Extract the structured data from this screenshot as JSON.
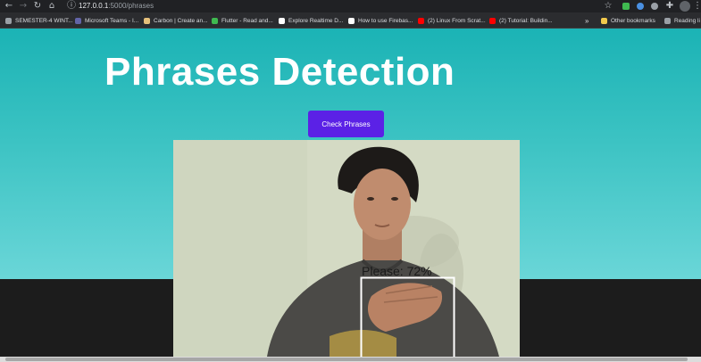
{
  "browser": {
    "url_host": "127.0.0.1",
    "url_path": ":5000/phrases",
    "bookmarks": [
      {
        "label": "SEMESTER-4 WINT...",
        "color": "#9aa0a6"
      },
      {
        "label": "Microsoft Teams - I...",
        "color": "#6264a7"
      },
      {
        "label": "Carbon | Create an...",
        "color": "#e5c07b"
      },
      {
        "label": "Flutter - Read and...",
        "color": "#3fb950"
      },
      {
        "label": "Explore Realtime D...",
        "color": "#ffffff"
      },
      {
        "label": "How to use Firebas...",
        "color": "#ffffff"
      },
      {
        "label": "(2) Linux From Scrat...",
        "color": "#ff0000"
      },
      {
        "label": "(2) Tutorial: Buildin...",
        "color": "#ff0000"
      }
    ],
    "more_label": "»",
    "other_bookmarks": "Other bookmarks",
    "reading_list": "Reading li"
  },
  "page": {
    "title": "Phrases Detection",
    "button_label": "Check Phrases"
  },
  "detection": {
    "label": "Please: 72%"
  },
  "colors": {
    "hero_top": "#1bb3b5",
    "hero_bottom": "#6ad6d8",
    "button": "#5b21e6",
    "dark_section": "#1c1c1c"
  }
}
